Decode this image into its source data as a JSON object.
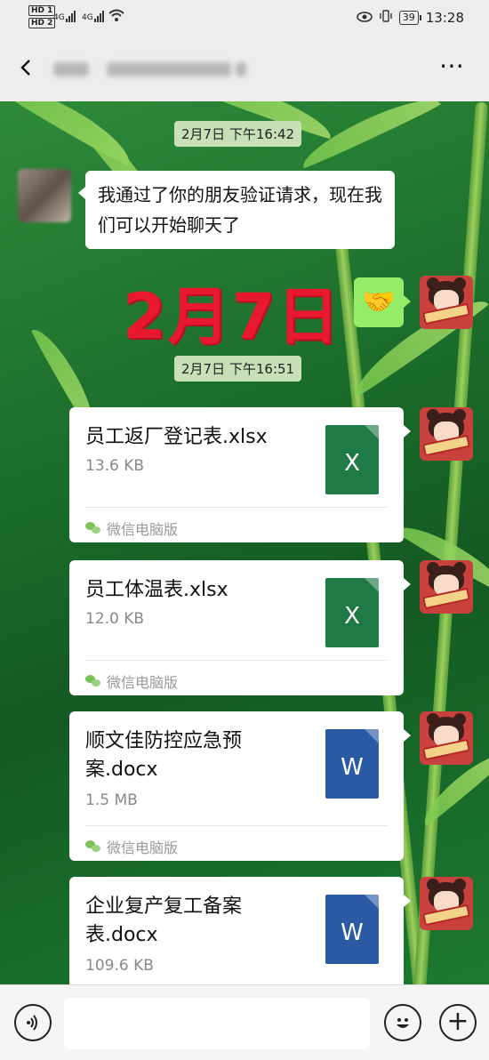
{
  "status_bar": {
    "hd1": "HD 1",
    "hd2": "HD 2",
    "net1": "4G",
    "net2": "4G",
    "battery": "39",
    "time": "13:28"
  },
  "header": {
    "back_icon": "back-icon",
    "more_icon": "⋯"
  },
  "messages": {
    "ts1": "2月7日 下午16:42",
    "friend_text": "我通过了你的朋友验证请求，现在我们可以开始聊天了",
    "big_date": "2月7日",
    "handshake": "🤝",
    "ts2": "2月7日 下午16:51",
    "files": [
      {
        "name": "员工返厂登记表.xlsx",
        "size": "13.6 KB",
        "type": "X",
        "source": "微信电脑版"
      },
      {
        "name": "员工体温表.xlsx",
        "size": "12.0 KB",
        "type": "X",
        "source": "微信电脑版"
      },
      {
        "name": "顺文佳防控应急预案.docx",
        "size": "1.5 MB",
        "type": "W",
        "source": "微信电脑版"
      },
      {
        "name": "企业复产复工备案表.docx",
        "size": "109.6 KB",
        "type": "W",
        "source": ""
      }
    ]
  },
  "input_bar": {
    "voice_icon": "🔊",
    "emoji_icon": "☺",
    "plus_icon": "+"
  },
  "colors": {
    "bubble_green": "#95ec69",
    "xls": "#1f7a45",
    "doc": "#2b5aa5",
    "big_date_red": "#e8182f"
  }
}
